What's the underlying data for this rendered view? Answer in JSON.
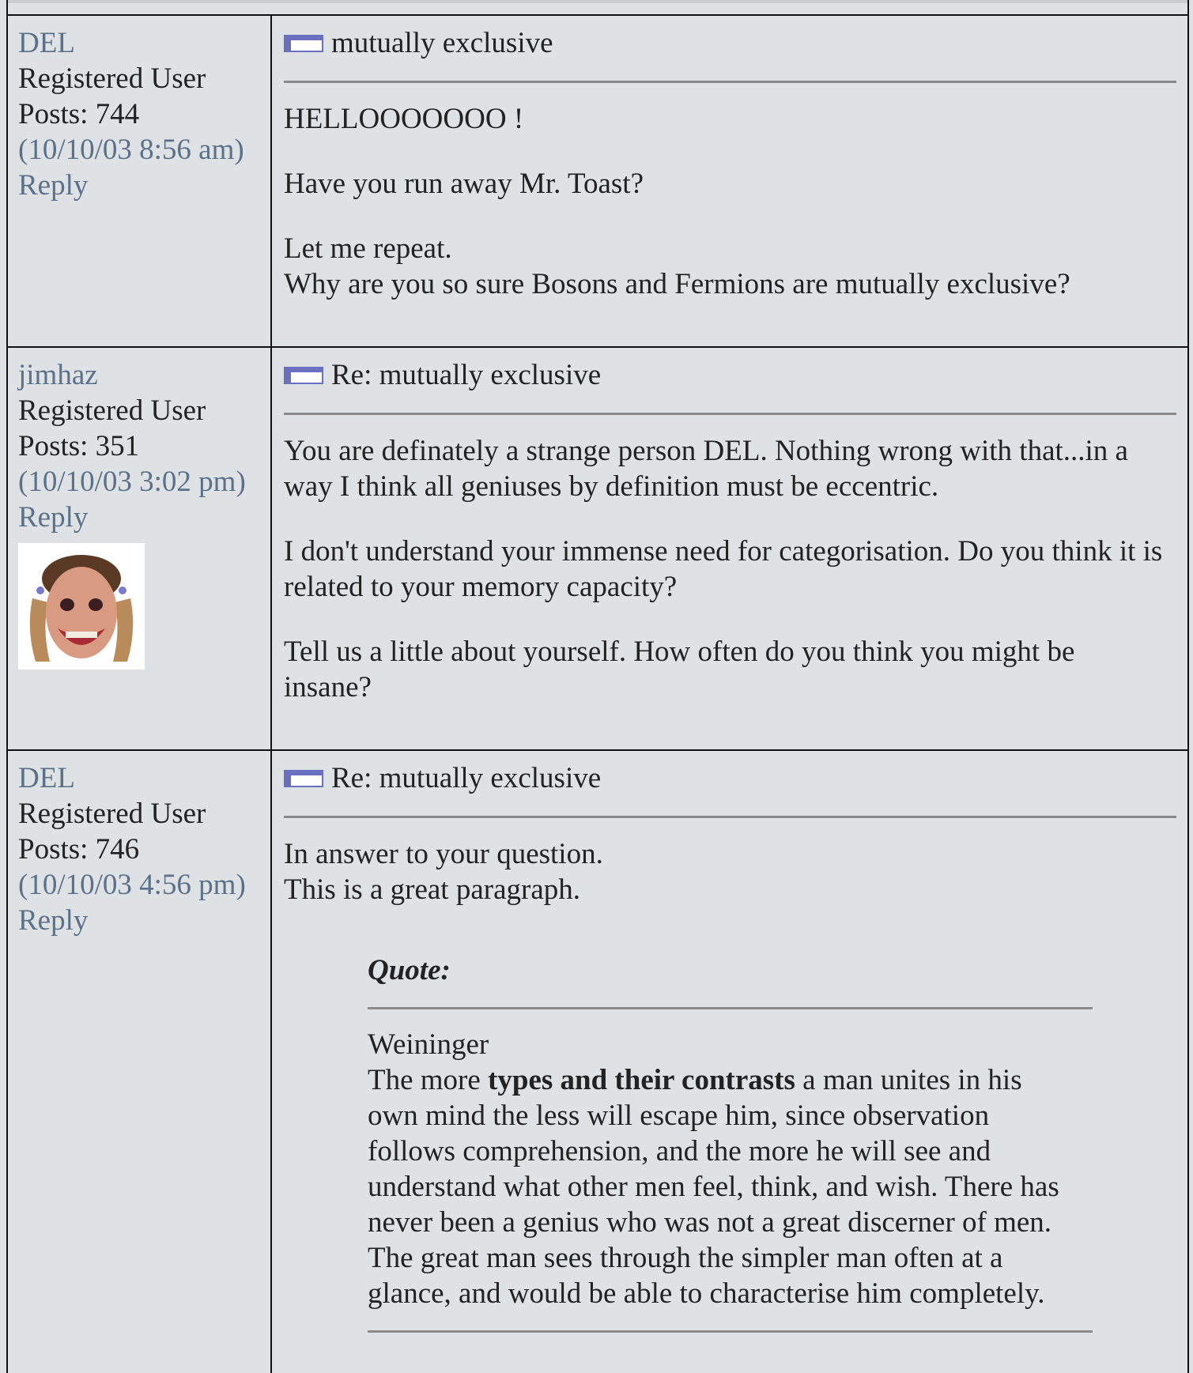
{
  "posts": [
    {
      "author": "DEL",
      "role": "Registered User",
      "posts": "Posts: 744",
      "date": "(10/10/03 8:56 am)",
      "reply": "Reply",
      "subject": "mutually exclusive",
      "paragraphs": [
        [
          "HELLOOOOOOO !"
        ],
        [
          "Have you run away Mr. Toast?"
        ],
        [
          "Let me repeat.",
          "Why are you so sure Bosons and Fermions are mutually exclusive?"
        ]
      ]
    },
    {
      "author": "jimhaz",
      "role": "Registered User",
      "posts": "Posts: 351",
      "date": "(10/10/03 3:02 pm)",
      "reply": "Reply",
      "subject": "Re: mutually exclusive",
      "paragraphs": [
        [
          "You are definately a strange person DEL. Nothing wrong with that...in a",
          "way I think all geniuses by definition must be eccentric."
        ],
        [
          "I don't understand your immense need for categorisation. Do you think it is",
          "related to your memory capacity?"
        ],
        [
          "Tell us a little about yourself. How often do you think you might be",
          "insane?"
        ]
      ]
    },
    {
      "author": "DEL",
      "role": "Registered User",
      "posts": "Posts: 746",
      "date": "(10/10/03 4:56 pm)",
      "reply": "Reply",
      "subject": "Re: mutually exclusive",
      "paragraphs": [
        [
          "In answer to your question.",
          "This is a great paragraph."
        ]
      ],
      "quote": {
        "label": "Quote:",
        "source": "Weininger",
        "line1_pre": "The more ",
        "line1_bold": "types and their contrasts",
        "line1_post": " a man unites in his",
        "lines": [
          "own mind the less will escape him, since observation",
          "follows comprehension, and the more he will see and",
          "understand what other men feel, think, and wish. There has",
          "never been a genius who was not a great discerner of men.",
          "The great man sees through the simpler man often at a",
          "glance, and would be able to characterise him completely."
        ]
      }
    }
  ],
  "colors": {
    "link": "#5b7089",
    "background": "#dfe2e5",
    "border": "#111111",
    "rule": "#8a8a8a"
  },
  "icons": {
    "subject": "message-subject-icon",
    "avatar": "user-avatar"
  }
}
